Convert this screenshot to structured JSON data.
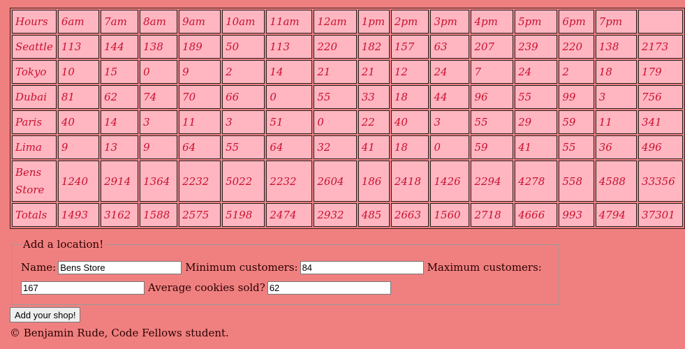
{
  "table": {
    "header": [
      "Hours",
      "6am",
      "7am",
      "8am",
      "9am",
      "10am",
      "11am",
      "12am",
      "1pm",
      "2pm",
      "3pm",
      "4pm",
      "5pm",
      "6pm",
      "7pm",
      ""
    ],
    "rows": [
      [
        "Seattle",
        "113",
        "144",
        "138",
        "189",
        "50",
        "113",
        "220",
        "182",
        "157",
        "63",
        "207",
        "239",
        "220",
        "138",
        "2173"
      ],
      [
        "Tokyo",
        "10",
        "15",
        "0",
        "9",
        "2",
        "14",
        "21",
        "21",
        "12",
        "24",
        "7",
        "24",
        "2",
        "18",
        "179"
      ],
      [
        "Dubai",
        "81",
        "62",
        "74",
        "70",
        "66",
        "0",
        "55",
        "33",
        "18",
        "44",
        "96",
        "55",
        "99",
        "3",
        "756"
      ],
      [
        "Paris",
        "40",
        "14",
        "3",
        "11",
        "3",
        "51",
        "0",
        "22",
        "40",
        "3",
        "55",
        "29",
        "59",
        "11",
        "341"
      ],
      [
        "Lima",
        "9",
        "13",
        "9",
        "64",
        "55",
        "64",
        "32",
        "41",
        "18",
        "0",
        "59",
        "41",
        "55",
        "36",
        "496"
      ],
      [
        "Bens Store",
        "1240",
        "2914",
        "1364",
        "2232",
        "5022",
        "2232",
        "2604",
        "186",
        "2418",
        "1426",
        "2294",
        "4278",
        "558",
        "4588",
        "33356"
      ]
    ],
    "totals": [
      "Totals",
      "1493",
      "3162",
      "1588",
      "2575",
      "5198",
      "2474",
      "2932",
      "485",
      "2663",
      "1560",
      "2718",
      "4666",
      "993",
      "4794",
      "37301"
    ]
  },
  "form": {
    "legend": "Add a location!",
    "name_label": "Name:",
    "name_value": "Bens Store",
    "min_label": "Minimum customers:",
    "min_value": "84",
    "max_label": "Maximum customers:",
    "max_value": "167",
    "avg_label": "Average cookies sold?",
    "avg_value": "62",
    "submit_label": "Add your shop!"
  },
  "footer": "© Benjamin Rude, Code Fellows student."
}
